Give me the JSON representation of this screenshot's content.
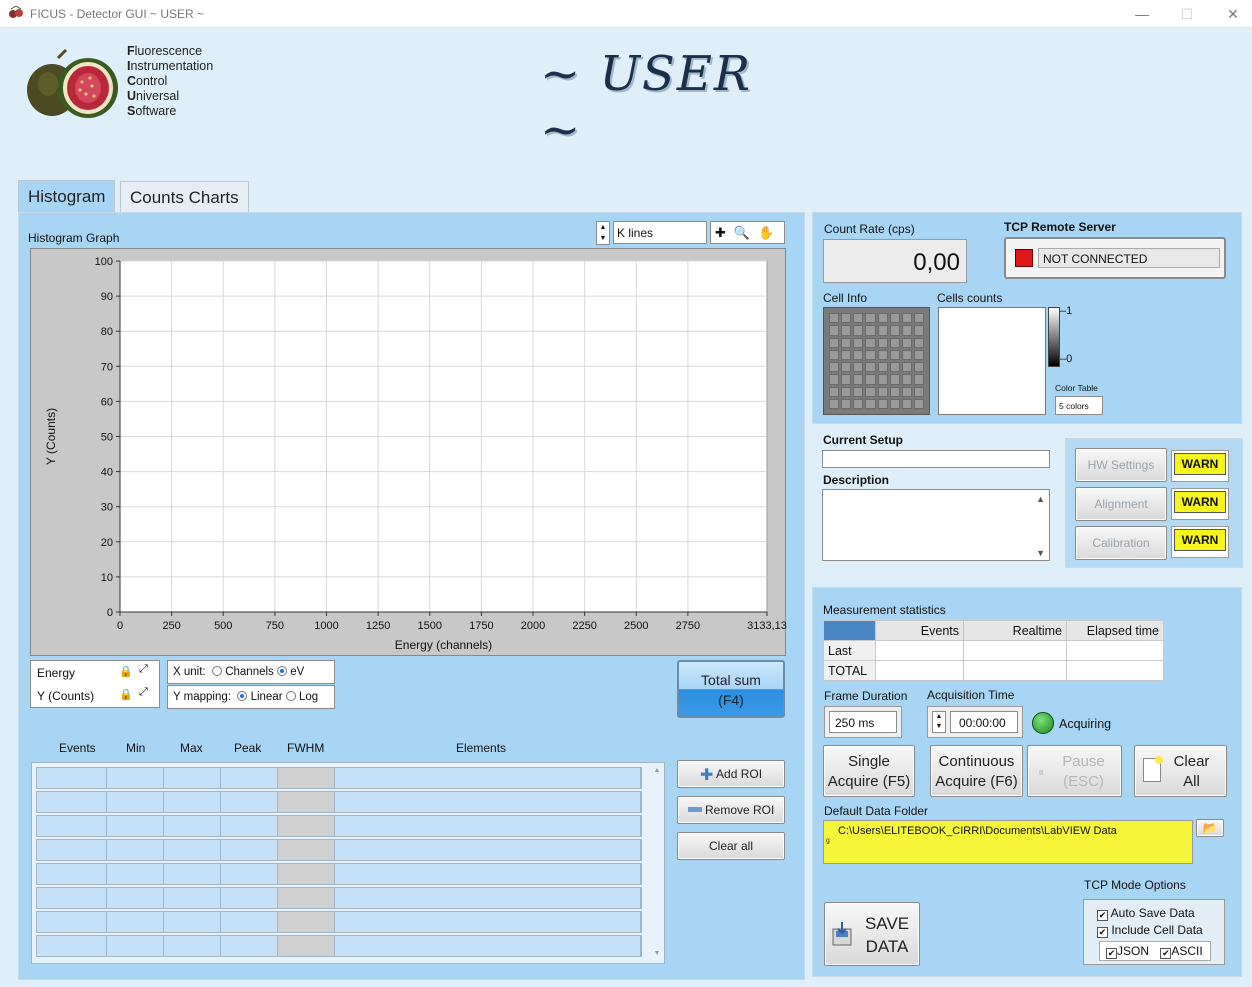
{
  "window": {
    "title": "FICUS - Detector GUI ~ USER ~",
    "minimize": "—",
    "maximize": "☐",
    "close": "✕"
  },
  "logo": {
    "lines": [
      {
        "cap": "F",
        "rest": "luorescence"
      },
      {
        "cap": "I",
        "rest": "nstrumentation"
      },
      {
        "cap": "C",
        "rest": "ontrol"
      },
      {
        "cap": "U",
        "rest": "niversal"
      },
      {
        "cap": "S",
        "rest": "oftware"
      }
    ]
  },
  "header": {
    "title": "~ USER ~"
  },
  "tabs": [
    {
      "label": "Histogram"
    },
    {
      "label": "Counts Charts"
    }
  ],
  "histogram": {
    "graph_label": "Histogram Graph",
    "kline_select": "K lines",
    "tools": [
      "plus-cursor-icon",
      "zoom-icon",
      "pan-hand-icon"
    ]
  },
  "chart_data": {
    "type": "line",
    "title": "",
    "xlabel": "Energy (channels)",
    "ylabel": "Y (Counts)",
    "xlim": [
      0,
      3133.13
    ],
    "ylim": [
      0,
      100
    ],
    "x_ticks": [
      "0",
      "250",
      "500",
      "750",
      "1000",
      "1250",
      "1500",
      "1750",
      "2000",
      "2250",
      "2500",
      "2750",
      "3133,13"
    ],
    "x_tick_values": [
      0,
      250,
      500,
      750,
      1000,
      1250,
      1500,
      1750,
      2000,
      2250,
      2500,
      2750,
      3133.13
    ],
    "y_ticks": [
      "0",
      "10",
      "20",
      "30",
      "40",
      "50",
      "60",
      "70",
      "80",
      "90",
      "100"
    ],
    "y_tick_values": [
      0,
      10,
      20,
      30,
      40,
      50,
      60,
      70,
      80,
      90,
      100
    ],
    "grid": true,
    "series": []
  },
  "scales": {
    "energy": "Energy",
    "counts": "Y (Counts)"
  },
  "xunit": {
    "label": "X unit:",
    "opt1": "Channels",
    "opt2": "eV",
    "selected": "eV"
  },
  "ymap": {
    "label": "Y mapping:",
    "opt1": "Linear",
    "opt2": "Log",
    "selected": "Linear"
  },
  "total_sum": {
    "line1": "Total sum",
    "line2": "(F4)"
  },
  "roi": {
    "columns": [
      "Events",
      "Min",
      "Max",
      "Peak",
      "FWHM",
      "Elements"
    ],
    "row_count": 8,
    "add": "Add ROI",
    "remove": "Remove ROI",
    "clear": "Clear all"
  },
  "count_rate": {
    "label": "Count Rate (cps)",
    "value": "0,00"
  },
  "tcp": {
    "label": "TCP Remote Server",
    "status": "NOT CONNECTED"
  },
  "cell_info": {
    "label": "Cell Info"
  },
  "cells_counts": {
    "label": "Cells counts",
    "scale_max": "1",
    "scale_min": "0",
    "color_table_label": "Color Table",
    "color_table_value": "5 colors"
  },
  "setup": {
    "current_label": "Current Setup",
    "current_value": "",
    "description_label": "Description",
    "description_value": ""
  },
  "hw": [
    {
      "label": "HW Settings",
      "warn": "WARN"
    },
    {
      "label": "Alignment",
      "warn": "WARN"
    },
    {
      "label": "Calibration",
      "warn": "WARN"
    }
  ],
  "stats": {
    "label": "Measurement statistics",
    "columns": [
      "",
      "Events",
      "Realtime",
      "Elapsed time"
    ],
    "rows": [
      "Last",
      "TOTAL"
    ]
  },
  "frame": {
    "label": "Frame Duration",
    "value": "250 ms"
  },
  "acq_time": {
    "label": "Acquisition Time",
    "value": "00:00:00",
    "status": "Acquiring"
  },
  "buttons": {
    "single1": "Single",
    "single2": "Acquire (F5)",
    "cont1": "Continuous",
    "cont2": "Acquire (F6)",
    "pause1": "Pause",
    "pause2": "(ESC)",
    "clear1": "Clear",
    "clear2": "All",
    "save1": "SAVE",
    "save2": "DATA"
  },
  "data_folder": {
    "label": "Default Data Folder",
    "path": "C:\\Users\\ELITEBOOK_CIRRI\\Documents\\LabVIEW Data"
  },
  "tcp_mode": {
    "label": "TCP Mode Options",
    "auto_save": "Auto Save Data",
    "include_cell": "Include Cell Data",
    "json": "JSON",
    "ascii": "ASCII"
  },
  "colors": {
    "panel": "#a9d5f5",
    "background": "#dfeffa",
    "warn": "#f5f51d",
    "path_bg": "#f5f53a"
  }
}
